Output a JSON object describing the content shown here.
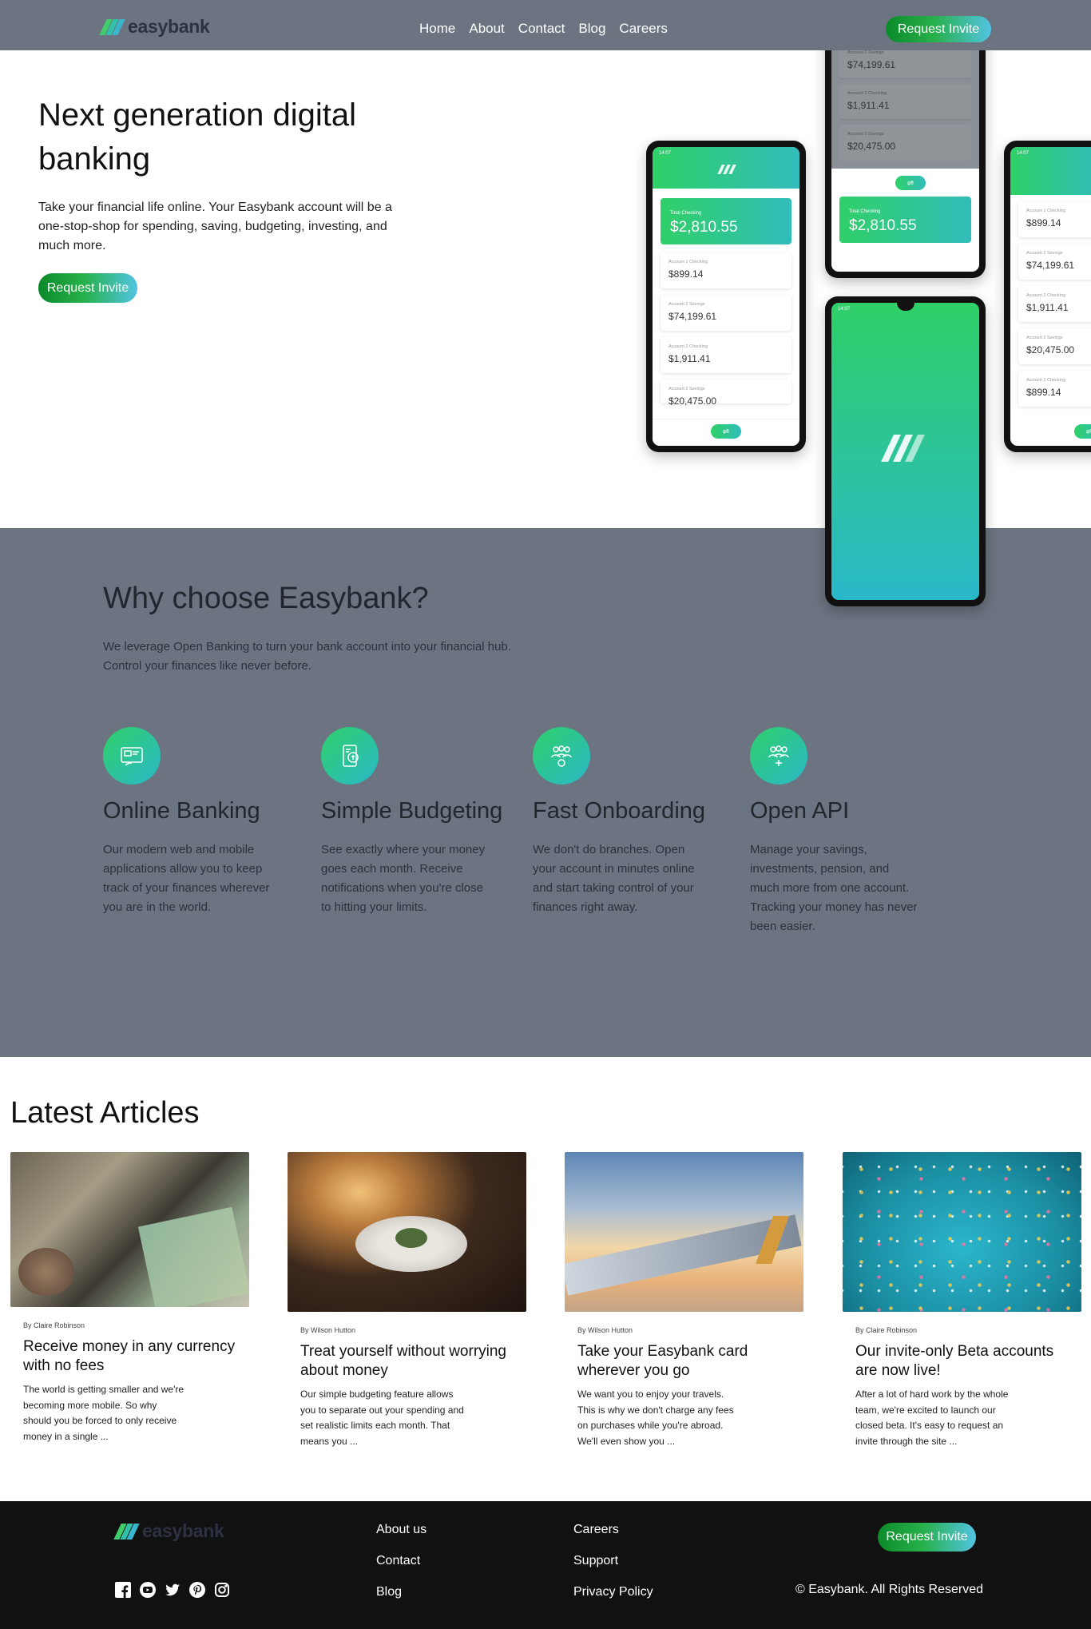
{
  "brand": {
    "name": "easybank"
  },
  "header": {
    "nav": [
      "Home",
      "About",
      "Contact",
      "Blog",
      "Careers"
    ],
    "cta": "Request Invite"
  },
  "hero": {
    "title": "Next generation digital banking",
    "body": "Take your financial life online. Your Easybank account will be a one-stop-shop for spending, saving, budgeting, investing, and much more.",
    "cta": "Request Invite"
  },
  "mockups": {
    "total_label": "Total Checking",
    "total_value": "$2,810.55",
    "time": "14:07",
    "accounts": [
      {
        "label": "Account 1 Checking",
        "value": "$899.14"
      },
      {
        "label": "Account 2 Savings",
        "value": "$74,199.61"
      },
      {
        "label": "Account 2 Checking",
        "value": "$1,911.41"
      },
      {
        "label": "Account 2 Savings",
        "value": "$20,475.00"
      },
      {
        "label": "Account 1 Checking",
        "value": "$899.14"
      }
    ]
  },
  "why": {
    "title": "Why choose Easybank?",
    "lead": "We leverage Open Banking to turn your bank account into your financial hub. Control your finances like never before.",
    "features": [
      {
        "icon": "online-banking-icon",
        "title": "Online Banking",
        "body": "Our modern web and mobile applications allow you to keep track of your finances wherever you are in the world."
      },
      {
        "icon": "budgeting-icon",
        "title": "Simple Budgeting",
        "body": "See exactly where your money goes each month. Receive notifications when you're close to hitting your limits."
      },
      {
        "icon": "onboarding-icon",
        "title": "Fast Onboarding",
        "body": "We don't do branches. Open your account in minutes online and start taking control of your finances right away."
      },
      {
        "icon": "api-icon",
        "title": "Open API",
        "body": "Manage your savings, investments, pension, and much more from one account. Tracking your money has never been easier."
      }
    ]
  },
  "articles": {
    "title": "Latest Articles",
    "items": [
      {
        "author": "By Claire Robinson",
        "title": "Receive money in any currency with no fees",
        "body": "The world is getting smaller and we're becoming more mobile. So why should you be forced to only receive money in a single ..."
      },
      {
        "author": "By Wilson Hutton",
        "title": "Treat yourself without worrying about money",
        "body": "Our simple budgeting feature allows you to separate out your spending and set realistic limits each month. That means you ..."
      },
      {
        "author": "By Wilson Hutton",
        "title": "Take your Easybank card wherever you go",
        "body": "We want you to enjoy your travels. This is why we don't charge any fees on purchases while you're abroad. We'll even show you ..."
      },
      {
        "author": "By Claire Robinson",
        "title": "Our invite-only Beta accounts are now live!",
        "body": "After a lot of hard work by the whole team, we're excited to launch our closed beta. It's easy to request an invite through the site ..."
      }
    ]
  },
  "footer": {
    "col1": [
      "About us",
      "Contact",
      "Blog"
    ],
    "col2": [
      "Careers",
      "Support",
      "Privacy Policy"
    ],
    "cta": "Request Invite",
    "copyright": "© Easybank. All Rights Reserved",
    "social": [
      "facebook-icon",
      "youtube-icon",
      "twitter-icon",
      "pinterest-icon",
      "instagram-icon"
    ]
  },
  "colors": {
    "header_bg": "#6b7480",
    "accent_green": "#2fd068",
    "accent_cyan": "#32bcbb",
    "footer_bg": "#111111"
  }
}
